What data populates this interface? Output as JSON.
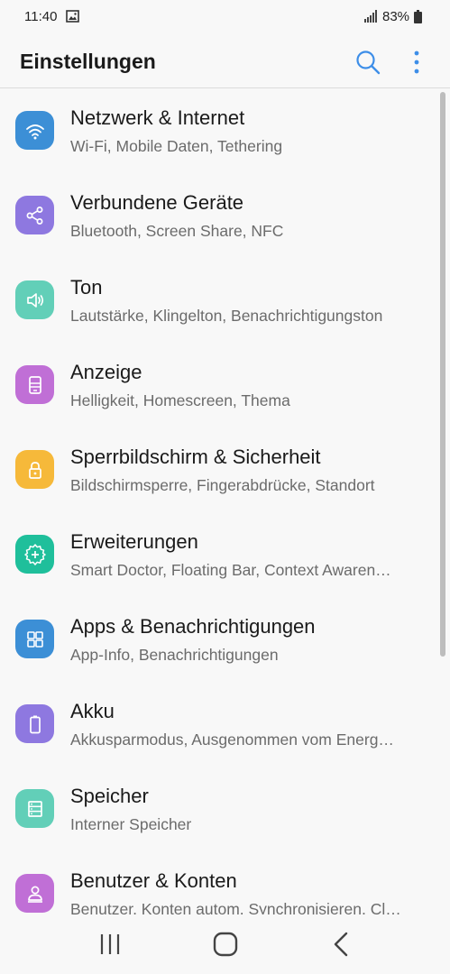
{
  "status_bar": {
    "time": "11:40",
    "battery_percent": "83%"
  },
  "app_bar": {
    "title": "Einstellungen",
    "accent_color": "#3d8ee8"
  },
  "settings_items": [
    {
      "title": "Netzwerk & Internet",
      "subtitle": "Wi-Fi, Mobile Daten, Tethering",
      "icon": "wifi-icon",
      "color": "#3c8fd6"
    },
    {
      "title": "Verbundene Geräte",
      "subtitle": "Bluetooth, Screen Share, NFC",
      "icon": "share-icon",
      "color": "#8e78e0"
    },
    {
      "title": "Ton",
      "subtitle": "Lautstärke, Klingelton, Benachrichtigungston",
      "icon": "speaker-icon",
      "color": "#62cfb8"
    },
    {
      "title": "Anzeige",
      "subtitle": "Helligkeit, Homescreen, Thema",
      "icon": "display-icon",
      "color": "#c06fd6"
    },
    {
      "title": "Sperrbildschirm & Sicherheit",
      "subtitle": "Bildschirmsperre, Fingerabdrücke, Standort",
      "icon": "lock-icon",
      "color": "#f6b93a"
    },
    {
      "title": "Erweiterungen",
      "subtitle": "Smart Doctor, Floating Bar, Context Awaren…",
      "icon": "gear-plus-icon",
      "color": "#1fbf9b"
    },
    {
      "title": "Apps & Benachrichtigungen",
      "subtitle": "App-Info, Benachrichtigungen",
      "icon": "apps-grid-icon",
      "color": "#3c8fd6"
    },
    {
      "title": "Akku",
      "subtitle": "Akkusparmodus, Ausgenommen vom Energ…",
      "icon": "battery-icon",
      "color": "#8e78e0"
    },
    {
      "title": "Speicher",
      "subtitle": "Interner Speicher",
      "icon": "storage-icon",
      "color": "#62cfb8"
    },
    {
      "title": "Benutzer & Konten",
      "subtitle": "Benutzer, Konten autom. Synchronisieren, Cl…",
      "icon": "user-icon",
      "color": "#c06fd6"
    }
  ]
}
